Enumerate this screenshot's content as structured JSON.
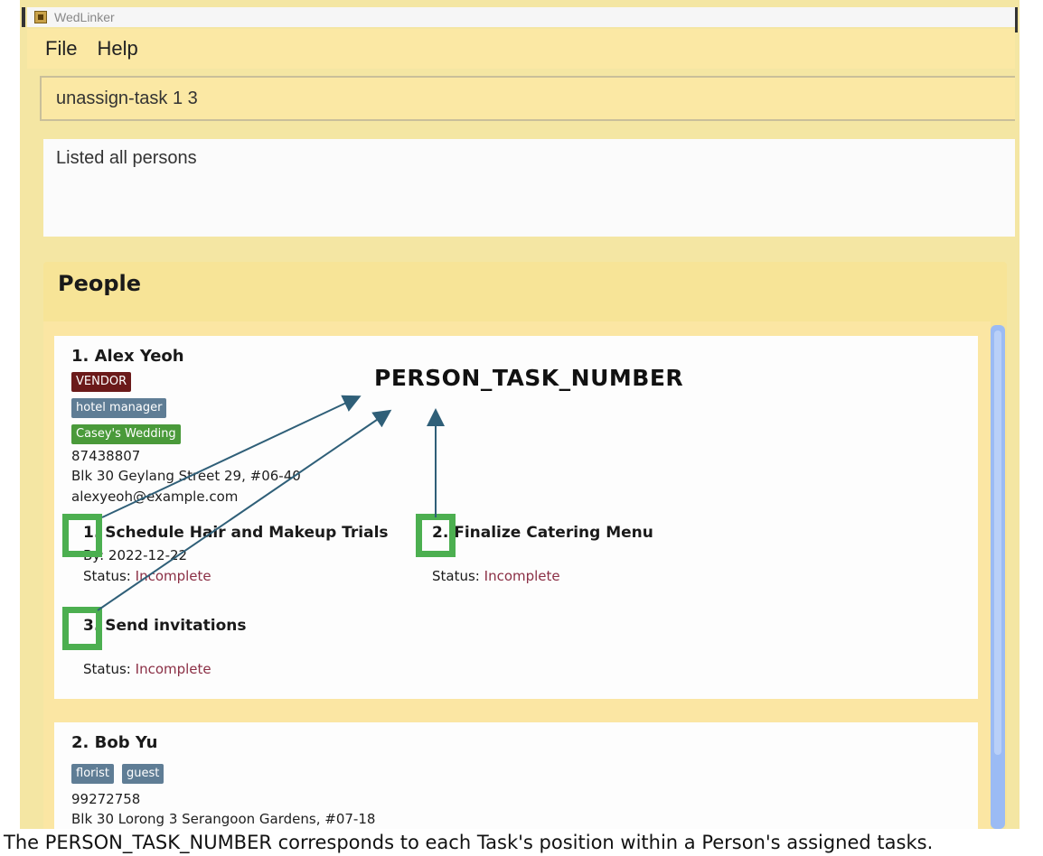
{
  "window": {
    "title": "WedLinker"
  },
  "menu": [
    "File",
    "Help"
  ],
  "command": {
    "value": "unassign-task 1 3"
  },
  "result": {
    "text": "Listed all persons"
  },
  "panel": {
    "title": "People"
  },
  "persons": [
    {
      "name": "1. Alex Yeoh",
      "tags": [
        {
          "label": "VENDOR",
          "color": "#6b1a1a"
        },
        {
          "label": "hotel manager",
          "color": "#5f7d95"
        },
        {
          "label": "Casey's Wedding",
          "color": "#4a9a3a"
        }
      ],
      "phone": "87438807",
      "address": "Blk 30 Geylang Street 29, #06-40",
      "email": "alexyeoh@example.com",
      "tasks": [
        {
          "number": "1.",
          "title": "Schedule Hair and Makeup Trials",
          "by": "By: 2022-12-22",
          "status_label": "Status:",
          "status": "Incomplete"
        },
        {
          "number": "2.",
          "title": "Finalize Catering Menu",
          "status_label": "Status:",
          "status": "Incomplete"
        },
        {
          "number": "3.",
          "title": "Send invitations",
          "status_label": "Status:",
          "status": "Incomplete"
        }
      ]
    },
    {
      "name": "2. Bob Yu",
      "tags": [
        {
          "label": "florist",
          "color": "#5f7d95"
        },
        {
          "label": "guest",
          "color": "#5f7d95"
        }
      ],
      "phone": "99272758",
      "address": "Blk 30 Lorong 3 Serangoon Gardens, #07-18"
    }
  ],
  "annotation": {
    "label": "PERSON_TASK_NUMBER",
    "box_color": "#4caf50",
    "arrow_color": "#2f5f78"
  },
  "caption": "The PERSON_TASK_NUMBER corresponds to each Task's position within a Person's assigned tasks."
}
